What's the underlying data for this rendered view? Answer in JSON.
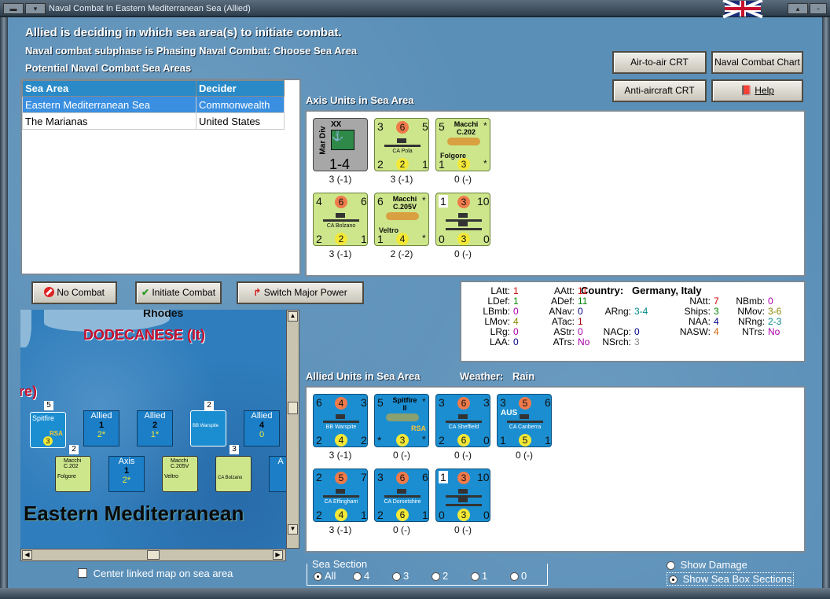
{
  "window": {
    "title": "Naval Combat In Eastern Mediterranean Sea (Allied)"
  },
  "header": {
    "line1": "Allied is deciding in which sea area(s) to initiate combat.",
    "line2": "Naval combat subphase is Phasing Naval Combat: Choose Sea Area",
    "line3": "Potential Naval Combat Sea Areas"
  },
  "top_buttons": {
    "air": "Air-to-air CRT",
    "naval": "Naval Combat Chart",
    "aa": "Anti-aircraft CRT",
    "help": "Help"
  },
  "sea_table": {
    "headers": [
      "Sea Area",
      "Decider"
    ],
    "rows": [
      [
        "Eastern Mediterranean Sea",
        "Commonwealth"
      ],
      [
        "The Marianas",
        "United States"
      ]
    ]
  },
  "axis": {
    "title": "Axis Units in Sea Area",
    "units": [
      {
        "kind": "div",
        "top": "XX",
        "side": "Mar Div",
        "val": "1-4",
        "cap": "3 (-1)"
      },
      {
        "kind": "ship",
        "a": "3",
        "c": "6",
        "b": "5",
        "name": "CA Pola",
        "d": "2",
        "e": "2",
        "f": "1",
        "cap": "3 (-1)"
      },
      {
        "kind": "plane",
        "a": "5",
        "title": "Macchi C.202",
        "name": "Folgore",
        "s": "*",
        "d": "1",
        "e": "3",
        "f": "*",
        "cap": "0 (-)"
      },
      {
        "kind": "ship",
        "a": "4",
        "c": "6",
        "b": "6",
        "name": "CA Bolzano",
        "d": "2",
        "e": "2",
        "f": "1",
        "cap": "3 (-1)"
      },
      {
        "kind": "plane",
        "a": "6",
        "title": "Macchi C.205V",
        "name": "Veltro",
        "s": "*",
        "d": "1",
        "e": "4",
        "f": "*",
        "cap": "2 (-2)"
      },
      {
        "kind": "convoy",
        "a": "1",
        "c": "3",
        "b": "10",
        "d": "0",
        "e": "3",
        "f": "0",
        "cap": "0 (-)"
      }
    ]
  },
  "combat_buttons": {
    "no": "No Combat",
    "init": "Initiate Combat",
    "switch": "Switch Major Power"
  },
  "stats": {
    "country_label": "Country:",
    "country": "Germany, Italy",
    "items": [
      [
        "LAtt:",
        "1",
        "#c00"
      ],
      [
        "LDef:",
        "1",
        "#080"
      ],
      [
        "LBmb:",
        "0",
        "#a0a"
      ],
      [
        "LMov:",
        "4",
        "#880"
      ],
      [
        "LRg:",
        "0",
        "#a0a"
      ],
      [
        "LAA:",
        "0",
        "#008"
      ],
      [
        "AAtt:",
        "11",
        "#c00"
      ],
      [
        "ADef:",
        "11",
        "#080"
      ],
      [
        "ANav:",
        "0",
        "#008"
      ],
      [
        "ATac:",
        "1",
        "#a00"
      ],
      [
        "AStr:",
        "0",
        "#a0a"
      ],
      [
        "ATrs:",
        "No",
        "#a0a"
      ],
      [
        "ARng:",
        "3-4",
        "#088"
      ],
      [
        "NACp:",
        "0",
        "#008"
      ],
      [
        "NSrch:",
        "3",
        "#888"
      ],
      [
        "NAtt:",
        "7",
        "#c00"
      ],
      [
        "Ships:",
        "3",
        "#080"
      ],
      [
        "NAA:",
        "4",
        "#008"
      ],
      [
        "NASW:",
        "4",
        "#c60"
      ],
      [
        "NBmb:",
        "0",
        "#a0a"
      ],
      [
        "NMov:",
        "3-6",
        "#880"
      ],
      [
        "NRng:",
        "2-3",
        "#088"
      ],
      [
        "NTrs:",
        "No",
        "#a0a"
      ]
    ]
  },
  "allied": {
    "title": "Allied Units in Sea Area",
    "weather_label": "Weather:",
    "weather": "Rain",
    "units": [
      {
        "kind": "ship",
        "a": "6",
        "c": "4",
        "b": "3",
        "name": "BB Warspite",
        "d": "2",
        "e": "4",
        "f": "2",
        "cap": "3 (-1)"
      },
      {
        "kind": "plane",
        "a": "5",
        "title": "Spitfire II",
        "name": "RSA",
        "s": "*",
        "d": "*",
        "e": "3",
        "f": "*",
        "cap": "0 (-)"
      },
      {
        "kind": "ship",
        "a": "3",
        "c": "6",
        "b": "3",
        "name": "CA Sheffield",
        "d": "2",
        "e": "6",
        "f": "0",
        "cap": "0 (-)"
      },
      {
        "kind": "ship",
        "a": "3",
        "c": "5",
        "b": "6",
        "name": "CA Canberra",
        "d": "1",
        "e": "5",
        "f": "1",
        "cap": "0 (-)",
        "tag": "AUS"
      },
      {
        "kind": "ship",
        "a": "2",
        "c": "5",
        "b": "7",
        "name": "CA Effingham",
        "d": "2",
        "e": "4",
        "f": "1",
        "cap": "3 (-1)"
      },
      {
        "kind": "ship",
        "a": "3",
        "c": "6",
        "b": "6",
        "name": "CA Dorsetshire",
        "d": "2",
        "e": "6",
        "f": "1",
        "cap": "0 (-)"
      },
      {
        "kind": "convoy",
        "a": "1",
        "c": "3",
        "b": "10",
        "d": "0",
        "e": "3",
        "f": "0",
        "cap": "0 (-)"
      }
    ]
  },
  "map": {
    "label_rhodes": "Rhodes",
    "label_dodecanese": "DODECANESE (It)",
    "label_re": "re)",
    "label_sea": "Eastern Mediterranean",
    "boxes": [
      [
        "Allied",
        "1",
        "2*"
      ],
      [
        "Allied",
        "2",
        "1*"
      ],
      [
        "Allied",
        "4",
        "0"
      ],
      [
        "Axis",
        "1",
        "2*"
      ],
      [
        "A",
        "",
        " "
      ]
    ],
    "counts": [
      "5",
      "2",
      "2",
      "3"
    ],
    "mini": {
      "spitfire": "Spitfire",
      "rsa": "RSA",
      "macchi1": "Macchi C.202",
      "folgore": "Folgore",
      "warspite": "BB Warspite",
      "macchi2": "Macchi C.205V",
      "veltro": "Veltro",
      "bolzano": "CA Bolzano"
    }
  },
  "center_map": "Center linked map on sea area",
  "sea_section": {
    "title": "Sea Section",
    "options": [
      "All",
      "4",
      "3",
      "2",
      "1",
      "0"
    ]
  },
  "show": {
    "damage": "Show Damage",
    "boxes": "Show Sea Box Sections"
  }
}
